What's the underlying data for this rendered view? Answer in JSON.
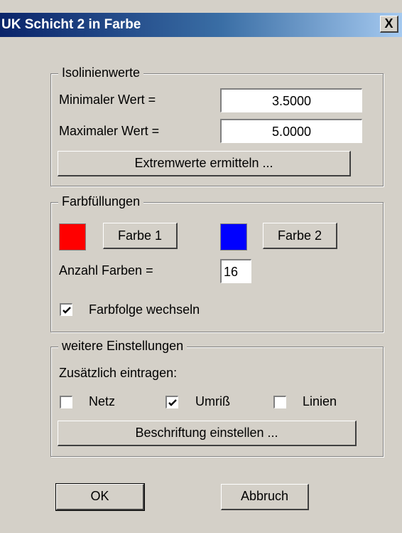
{
  "window": {
    "title": "UK Schicht 2 in Farbe",
    "close_label": "X"
  },
  "isolinien": {
    "legend": "Isolinienwerte",
    "min_label": "Minimaler Wert =",
    "min_value": "3.5000",
    "max_label": "Maximaler Wert =",
    "max_value": "5.0000",
    "extrem_button": "Extremwerte ermitteln ..."
  },
  "farb": {
    "legend": "Farbfüllungen",
    "color1": "#ff0000",
    "color1_button": "Farbe 1",
    "color2": "#0000ff",
    "color2_button": "Farbe 2",
    "anzahl_label": "Anzahl Farben =",
    "anzahl_value": "16",
    "wechseln_label": "Farbfolge wechseln",
    "wechseln_checked": true
  },
  "weitere": {
    "legend": "weitere Einstellungen",
    "zusaetzlich_label": "Zusätzlich eintragen:",
    "netz_label": "Netz",
    "netz_checked": false,
    "umriss_label": "Umriß",
    "umriss_checked": true,
    "linien_label": "Linien",
    "linien_checked": false,
    "beschriftung_button": "Beschriftung einstellen ..."
  },
  "buttons": {
    "ok": "OK",
    "cancel": "Abbruch"
  }
}
